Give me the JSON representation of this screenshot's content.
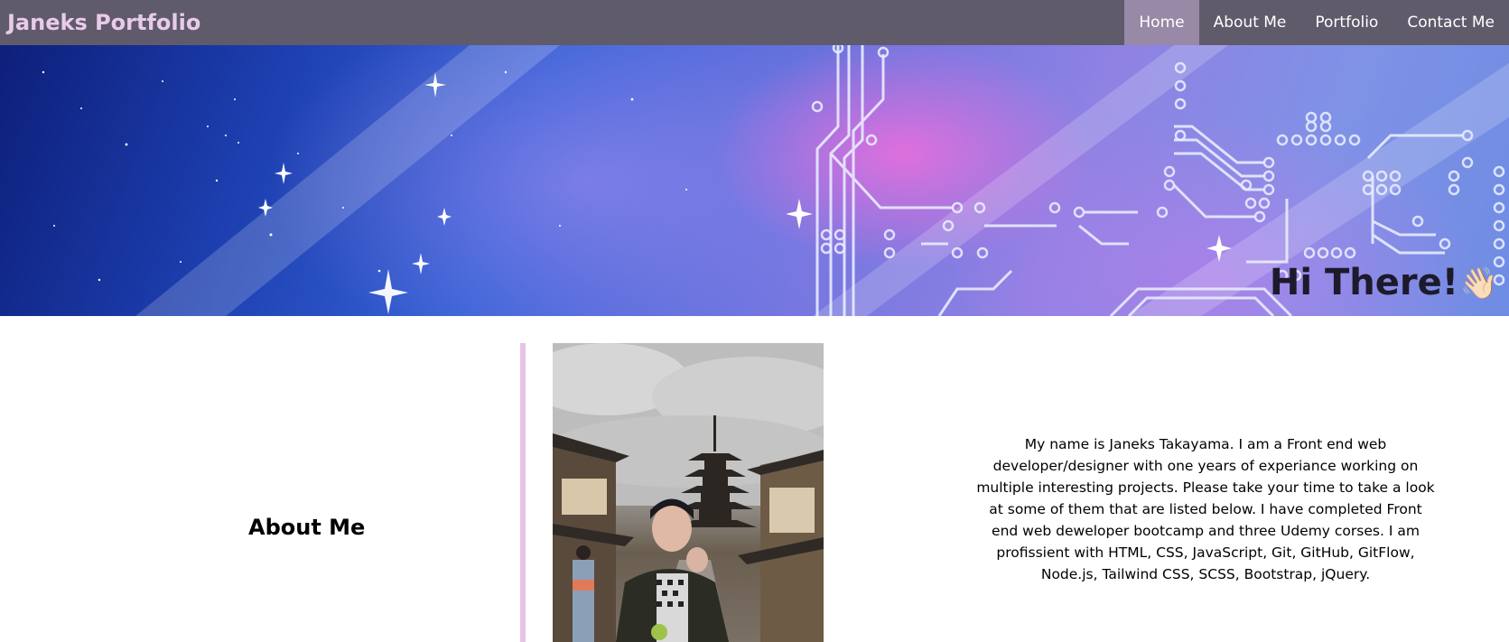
{
  "navbar": {
    "brand": "Janeks Portfolio",
    "links": [
      "Home",
      "About Me",
      "Portfolio",
      "Contact Me"
    ],
    "active": "Home"
  },
  "hero": {
    "title": "Hi There!",
    "emoji": "👋🏻"
  },
  "about": {
    "heading": "About Me",
    "text": "My name is Janeks Takayama. I am a Front end web developer/designer with one years of experiance working on multiple interesting projects. Please take your time to take a look at some of them that are listed below. I have completed Front end web deweloper bootcamp and three Udemy corses. I am profissient with HTML, CSS, JavaScript, Git, GitHub, GitFlow, Node.js, Tailwind CSS, SCSS, Bootstrap, jQuery."
  },
  "colors": {
    "navbar_bg": "#5f5b6b",
    "brand": "#e9cbe9",
    "nav_active": "#9889a6",
    "divider": "#e9c3e6"
  },
  "icons": {
    "wave": "waving-hand-icon"
  }
}
